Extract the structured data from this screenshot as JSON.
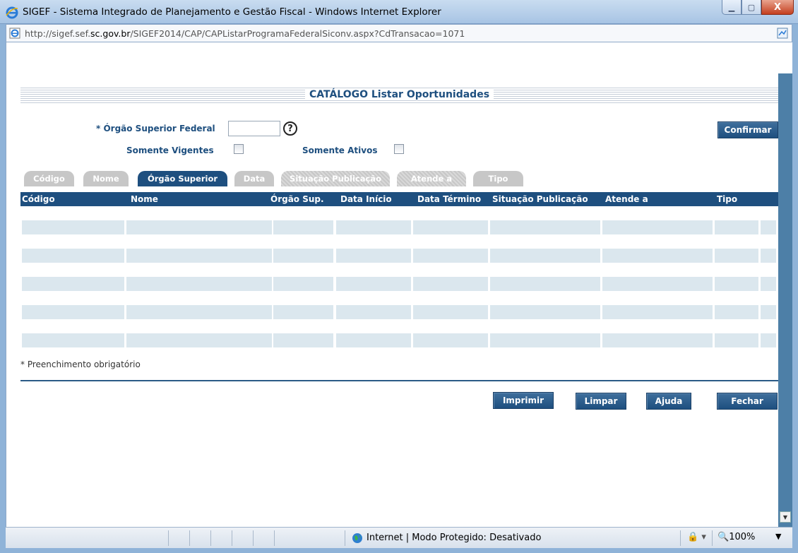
{
  "window": {
    "title": "SIGEF - Sistema Integrado de Planejamento e Gestão Fiscal - Windows Internet Explorer",
    "minimize": "▁",
    "maximize": "▢",
    "close": "X"
  },
  "address": {
    "prefix": "http://sigef.sef.",
    "domain": "sc.gov.br",
    "path": "/SIGEF2014/CAP/CAPListarProgramaFederalSiconv.aspx?CdTransacao=1071"
  },
  "page": {
    "title": "CATÁLOGO Listar Oportunidades",
    "orgao_label": "* Órgão Superior Federal",
    "orgao_value": "",
    "help": "?",
    "somente_vigentes_label": "Somente Vigentes",
    "somente_ativos_label": "Somente Ativos",
    "confirm_button": "Confirmar",
    "footnote": "* Preenchimento obrigatório"
  },
  "tabs": [
    {
      "label": "Código",
      "state": "inactive"
    },
    {
      "label": "Nome",
      "state": "inactive"
    },
    {
      "label": "Órgão Superior",
      "state": "active"
    },
    {
      "label": "Data",
      "state": "inactive"
    },
    {
      "label": "Situação Publicação",
      "state": "hatched"
    },
    {
      "label": "Atende a",
      "state": "hatched"
    },
    {
      "label": "Tipo",
      "state": "inactive"
    }
  ],
  "grid": {
    "headers": [
      "Código",
      "Nome",
      "Órgão Sup.",
      "Data Início",
      "Data Término",
      "Situação Publicação",
      "Atende a",
      "Tipo"
    ],
    "rows": [
      [
        "",
        "",
        "",
        "",
        "",
        "",
        "",
        ""
      ],
      [
        "",
        "",
        "",
        "",
        "",
        "",
        "",
        ""
      ],
      [
        "",
        "",
        "",
        "",
        "",
        "",
        "",
        ""
      ],
      [
        "",
        "",
        "",
        "",
        "",
        "",
        "",
        ""
      ],
      [
        "",
        "",
        "",
        "",
        "",
        "",
        "",
        ""
      ]
    ]
  },
  "actions": {
    "print": "Imprimir",
    "clear": "Limpar",
    "help": "Ajuda",
    "close": "Fechar"
  },
  "status": {
    "zone": "Internet | Modo Protegido: Desativado",
    "zoom": "100%"
  },
  "colors": {
    "brand": "#1e4f7f",
    "row_fill": "#dbe7ee",
    "tab_inactive": "#c7c7c7"
  }
}
